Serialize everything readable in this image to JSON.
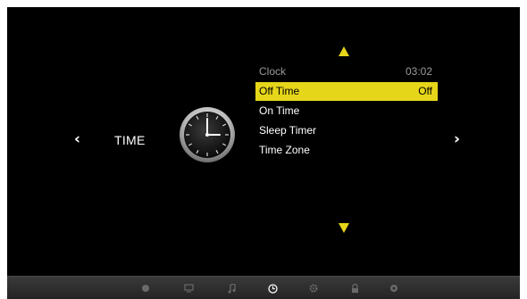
{
  "menu": {
    "category": "TIME",
    "nav_left": "‹",
    "nav_right": "›",
    "items": [
      {
        "label": "Clock",
        "value": "03:02"
      },
      {
        "label": "Off Time",
        "value": "Off"
      },
      {
        "label": "On Time",
        "value": ""
      },
      {
        "label": "Sleep Timer",
        "value": ""
      },
      {
        "label": "Time Zone",
        "value": ""
      }
    ]
  },
  "bottom_bar": {
    "icons": [
      "picture-icon",
      "screen-icon",
      "music-note-icon",
      "clock-icon",
      "gear-icon",
      "lock-icon",
      "settings-icon"
    ],
    "active": "clock-icon"
  },
  "colors": {
    "accent": "#e6d61a",
    "background": "#000000",
    "text": "#ffffff",
    "disabled_text": "#9a9a9a"
  }
}
